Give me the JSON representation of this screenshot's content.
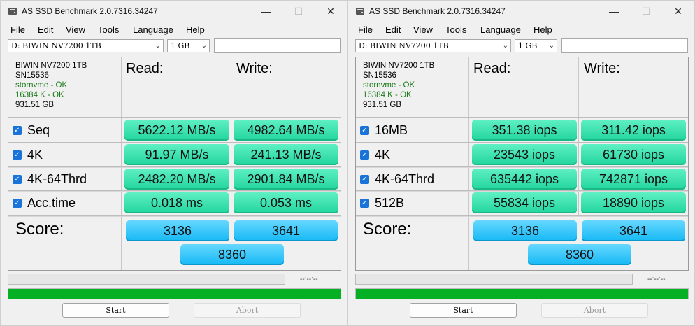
{
  "windows": [
    {
      "title": "AS SSD Benchmark 2.0.7316.34247",
      "menu": [
        "File",
        "Edit",
        "View",
        "Tools",
        "Language",
        "Help"
      ],
      "drive_select": "D: BIWIN NV7200 1TB",
      "size_select": "1 GB",
      "drive_info": {
        "model": "BIWIN NV7200 1TB",
        "firmware": "SN15536",
        "driver": "stornvme - OK",
        "alignment": "16384 K - OK",
        "capacity": "931.51 GB"
      },
      "headers": {
        "read": "Read:",
        "write": "Write:"
      },
      "rows": [
        {
          "label": "Seq",
          "read": "5622.12 MB/s",
          "write": "4982.64 MB/s"
        },
        {
          "label": "4K",
          "read": "91.97 MB/s",
          "write": "241.13 MB/s"
        },
        {
          "label": "4K-64Thrd",
          "read": "2482.20 MB/s",
          "write": "2901.84 MB/s"
        },
        {
          "label": "Acc.time",
          "read": "0.018 ms",
          "write": "0.053 ms"
        }
      ],
      "score": {
        "label": "Score:",
        "read": "3136",
        "write": "3641",
        "total": "8360"
      },
      "timer": "--:--:--",
      "progress": 1.0,
      "buttons": {
        "start": "Start",
        "abort": "Abort"
      }
    },
    {
      "title": "AS SSD Benchmark 2.0.7316.34247",
      "menu": [
        "File",
        "Edit",
        "View",
        "Tools",
        "Language",
        "Help"
      ],
      "drive_select": "D: BIWIN NV7200 1TB",
      "size_select": "1 GB",
      "drive_info": {
        "model": "BIWIN NV7200 1TB",
        "firmware": "SN15536",
        "driver": "stornvme - OK",
        "alignment": "16384 K - OK",
        "capacity": "931.51 GB"
      },
      "headers": {
        "read": "Read:",
        "write": "Write:"
      },
      "rows": [
        {
          "label": "16MB",
          "read": "351.38 iops",
          "write": "311.42 iops"
        },
        {
          "label": "4K",
          "read": "23543 iops",
          "write": "61730 iops"
        },
        {
          "label": "4K-64Thrd",
          "read": "635442 iops",
          "write": "742871 iops"
        },
        {
          "label": "512B",
          "read": "55834 iops",
          "write": "18890 iops"
        }
      ],
      "score": {
        "label": "Score:",
        "read": "3136",
        "write": "3641",
        "total": "8360"
      },
      "timer": "--:--:--",
      "progress": 1.0,
      "buttons": {
        "start": "Start",
        "abort": "Abort"
      }
    }
  ],
  "colors": {
    "result_cell": "#22d59c",
    "score_cell": "#15b8f5",
    "progress": "#06b025",
    "ok_text": "#1a7a1a"
  }
}
